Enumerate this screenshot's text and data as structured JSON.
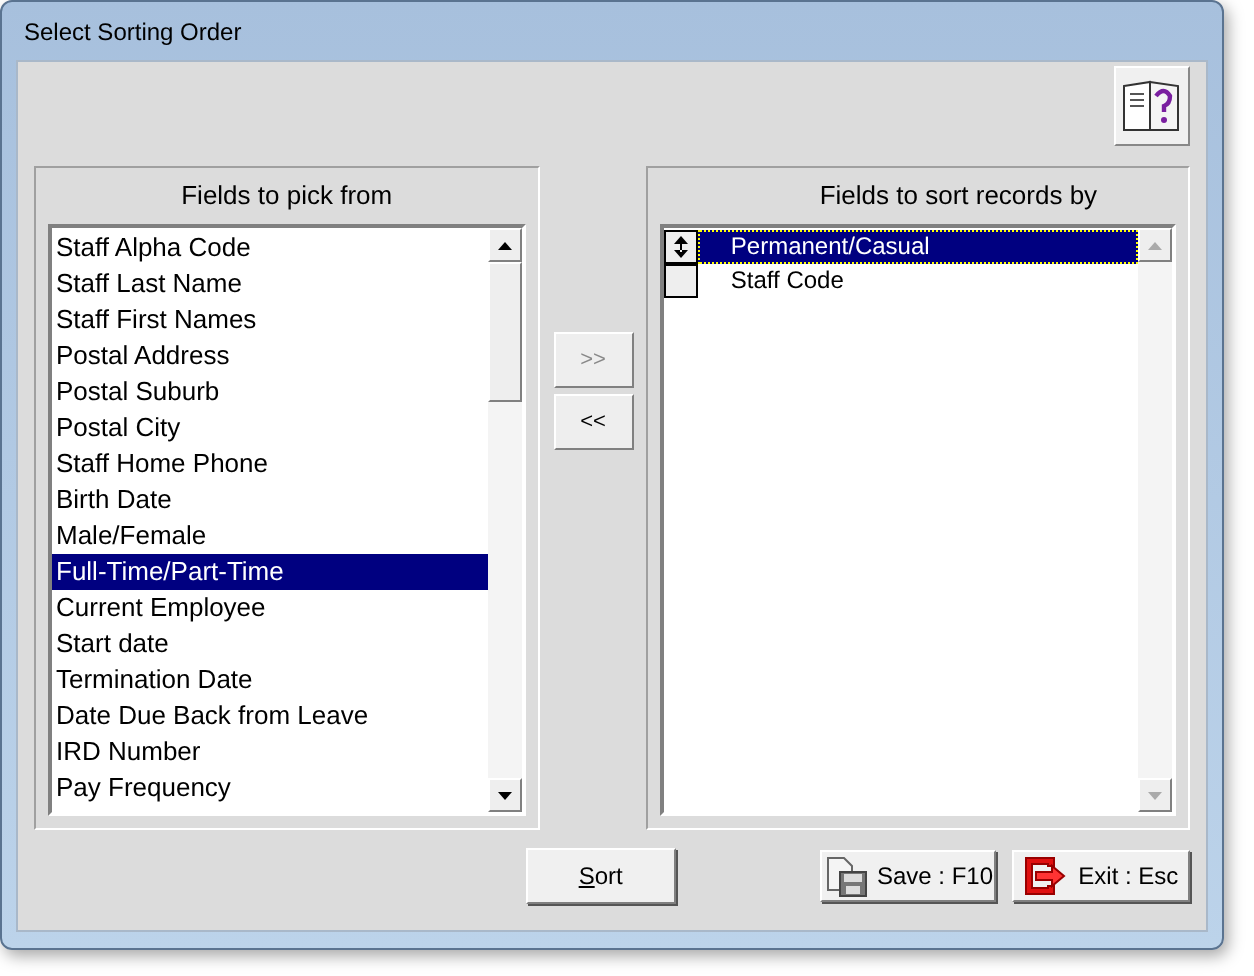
{
  "window": {
    "title": "Select Sorting Order"
  },
  "pick_panel": {
    "title": "Fields to pick from",
    "items": [
      {
        "label": "Staff Alpha Code",
        "selected": false
      },
      {
        "label": "Staff Last Name",
        "selected": false
      },
      {
        "label": "Staff First Names",
        "selected": false
      },
      {
        "label": "Postal Address",
        "selected": false
      },
      {
        "label": "Postal Suburb",
        "selected": false
      },
      {
        "label": "Postal City",
        "selected": false
      },
      {
        "label": "Staff Home Phone",
        "selected": false
      },
      {
        "label": "Birth Date",
        "selected": false
      },
      {
        "label": "Male/Female",
        "selected": false
      },
      {
        "label": "Full-Time/Part-Time",
        "selected": true
      },
      {
        "label": "Current Employee",
        "selected": false
      },
      {
        "label": "Start date",
        "selected": false
      },
      {
        "label": "Termination Date",
        "selected": false
      },
      {
        "label": "Date Due Back from Leave",
        "selected": false
      },
      {
        "label": "IRD Number",
        "selected": false
      },
      {
        "label": "Pay Frequency",
        "selected": false
      }
    ]
  },
  "move_buttons": [
    {
      "label": ">>",
      "disabled": true
    },
    {
      "label": "<<",
      "disabled": false
    }
  ],
  "sort_panel": {
    "title": "Fields to sort records by",
    "items": [
      {
        "label": "Permanent/Casual",
        "selected": true
      },
      {
        "label": "Staff Code",
        "selected": false
      }
    ]
  },
  "buttons": [
    {
      "kind": "sort",
      "label": "Sort"
    },
    {
      "kind": "save",
      "label": "Save : F10"
    },
    {
      "kind": "exit",
      "label": "Exit : Esc"
    }
  ]
}
